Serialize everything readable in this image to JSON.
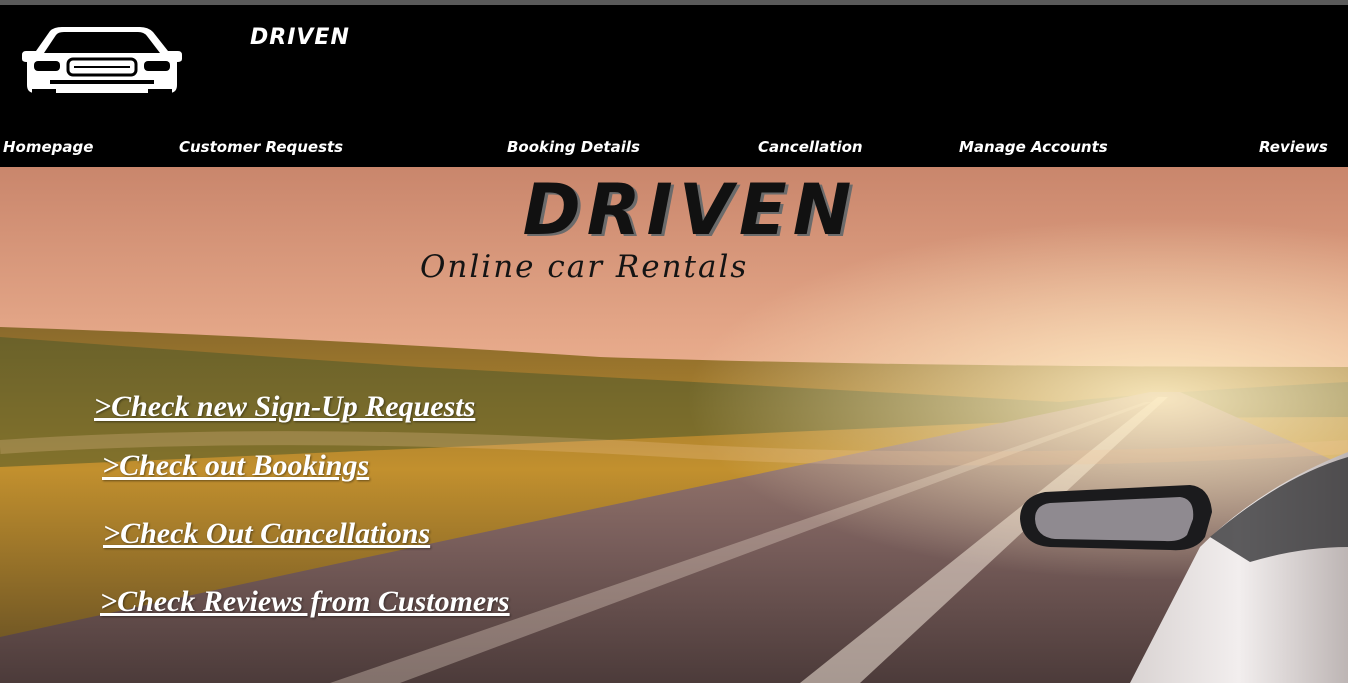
{
  "header": {
    "brand": "DRIVEN",
    "logo_icon": "car-front-icon"
  },
  "nav": {
    "items": [
      {
        "label": "Homepage"
      },
      {
        "label": "Customer Requests"
      },
      {
        "label": "Booking Details"
      },
      {
        "label": "Cancellation"
      },
      {
        "label": "Manage Accounts"
      },
      {
        "label": "Reviews"
      }
    ]
  },
  "hero": {
    "title": "DRIVEN",
    "subtitle": "Online car Rentals"
  },
  "actions": {
    "items": [
      {
        "label": ">Check new Sign-Up Requests"
      },
      {
        "label": ">Check out Bookings"
      },
      {
        "label": ">Check Out Cancellations"
      },
      {
        "label": ">Check Reviews from Customers"
      }
    ]
  },
  "colors": {
    "header_bg": "#000000",
    "nav_text": "#ffffff",
    "link_text": "#ffffff",
    "sky": "#e8a582"
  }
}
